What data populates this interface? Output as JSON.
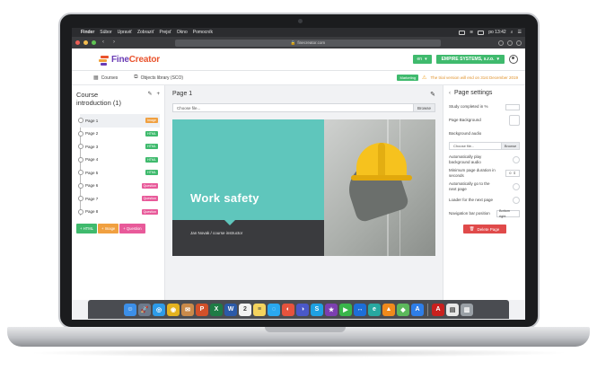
{
  "menubar": {
    "app": "Finder",
    "items": [
      "Súbor",
      "Upraviť",
      "Zobraziť",
      "Prejsť",
      "Okno",
      "Pomocník"
    ],
    "time": "po 13:42"
  },
  "browser": {
    "url": "finecreator.com"
  },
  "header": {
    "logo_text_1": "Fine",
    "logo_text_2": "Creator",
    "language": "en",
    "organization": "EMPIRE SYSTEMS, s.r.o."
  },
  "subheader": {
    "courses": "Courses",
    "objects_library": "Objects library (SCO)",
    "marketing_badge": "Marketing",
    "trial_text": "The trial version will end on 31st December 2019"
  },
  "left_panel": {
    "title": "Course introduction (1)",
    "pages": [
      {
        "label": "Page 1",
        "type": "Image",
        "color": "#f0a040"
      },
      {
        "label": "Page 2",
        "type": "HTML",
        "color": "#3fba6d"
      },
      {
        "label": "Page 3",
        "type": "HTML",
        "color": "#3fba6d"
      },
      {
        "label": "Page 4",
        "type": "HTML",
        "color": "#3fba6d"
      },
      {
        "label": "Page 5",
        "type": "HTML",
        "color": "#3fba6d"
      },
      {
        "label": "Page 6",
        "type": "Question",
        "color": "#e85a9a"
      },
      {
        "label": "Page 7",
        "type": "Question",
        "color": "#e85a9a"
      },
      {
        "label": "Page 8",
        "type": "Question",
        "color": "#e85a9a"
      }
    ],
    "add_html": "+ HTML",
    "add_image": "+ Image",
    "add_question": "+ Question"
  },
  "center": {
    "page_title": "Page 1",
    "file_placeholder": "Choose file...",
    "browse": "Browse",
    "slide_title": "Work safety",
    "slide_subtitle": "Jan Novak / course instructor"
  },
  "settings": {
    "title": "Page settings",
    "study_completed": "Study completed in %",
    "page_background": "Page Background",
    "background_audio": "Background audio",
    "audio_placeholder": "Choose file...",
    "audio_browse": "Browse",
    "autoplay": "Automatically play background audio",
    "min_duration": "Minimum page duration in seconds",
    "min_duration_value": "0",
    "auto_next": "Automatically go to the next page",
    "loader": "Loader for the next page",
    "nav_position": "Navigation bar position",
    "nav_position_value": "Bottom right",
    "delete": "Delete Page"
  },
  "colors": {
    "accent_green": "#3fba6d",
    "teal": "#5fc6bc",
    "danger": "#e04a4a",
    "brand_purple": "#6a3cb5"
  },
  "dock": [
    {
      "name": "finder-icon",
      "glyph": "☺",
      "color": "#3c8fe8"
    },
    {
      "name": "launchpad-icon",
      "glyph": "🚀",
      "color": "#6d7a8c"
    },
    {
      "name": "safari-icon",
      "glyph": "◎",
      "color": "#2d9be8"
    },
    {
      "name": "chrome-icon",
      "glyph": "◉",
      "color": "#e3b21f"
    },
    {
      "name": "mail-icon",
      "glyph": "✉",
      "color": "#c98a4a"
    },
    {
      "name": "powerpoint-icon",
      "glyph": "P",
      "color": "#d2502a"
    },
    {
      "name": "excel-icon",
      "glyph": "X",
      "color": "#1f7b45"
    },
    {
      "name": "word-icon",
      "glyph": "W",
      "color": "#2b5aa8"
    },
    {
      "name": "calendar-icon",
      "glyph": "2",
      "color": "#f2f2f2"
    },
    {
      "name": "notes-icon",
      "glyph": "≡",
      "color": "#f4d35e"
    },
    {
      "name": "messages-icon",
      "glyph": "◌",
      "color": "#2aa8ef"
    },
    {
      "name": "sync-icon",
      "glyph": "◐",
      "color": "#e6533d"
    },
    {
      "name": "app-icon",
      "glyph": "◑",
      "color": "#4a58c8"
    },
    {
      "name": "skype-icon",
      "glyph": "S",
      "color": "#1ea1e3"
    },
    {
      "name": "imovie-icon",
      "glyph": "★",
      "color": "#7c3fb0"
    },
    {
      "name": "facetime-icon",
      "glyph": "▶",
      "color": "#39b54a"
    },
    {
      "name": "teamviewer-icon",
      "glyph": "↔",
      "color": "#1d6ed8"
    },
    {
      "name": "edge-icon",
      "glyph": "e",
      "color": "#28a8a0"
    },
    {
      "name": "vlc-icon",
      "glyph": "▲",
      "color": "#f08a1c"
    },
    {
      "name": "maps-icon",
      "glyph": "◆",
      "color": "#5cb85c"
    },
    {
      "name": "app-store-icon",
      "glyph": "A",
      "color": "#2e7ee8"
    },
    {
      "name": "acrobat-icon",
      "glyph": "A",
      "color": "#c8201e"
    },
    {
      "name": "document-icon",
      "glyph": "▤",
      "color": "#e8e8e8"
    },
    {
      "name": "trash-icon",
      "glyph": "▥",
      "color": "#9aa0a6"
    }
  ]
}
